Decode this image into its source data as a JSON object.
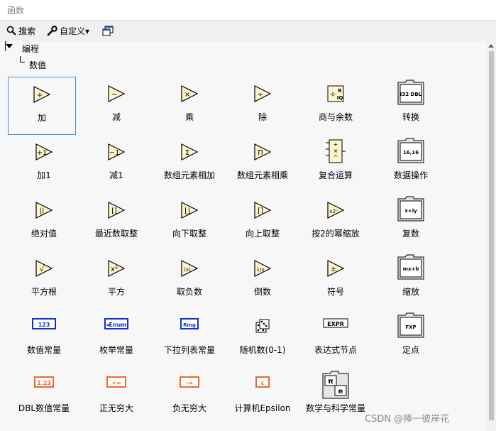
{
  "window": {
    "title": "函数"
  },
  "toolbar": {
    "search_label": "搜索",
    "customize_label": "自定义▾"
  },
  "tree": {
    "root_label": "编程",
    "child_label": "数值"
  },
  "palette": [
    {
      "label": "加",
      "icon": "add-icon",
      "glyph": "+",
      "kind": "tri"
    },
    {
      "label": "减",
      "icon": "subtract-icon",
      "glyph": "−",
      "kind": "tri"
    },
    {
      "label": "乘",
      "icon": "multiply-icon",
      "glyph": "×",
      "kind": "tri"
    },
    {
      "label": "除",
      "icon": "divide-icon",
      "glyph": "÷",
      "kind": "tri"
    },
    {
      "label": "商与余数",
      "icon": "quotient-remainder-icon",
      "glyph": "÷R",
      "kind": "box"
    },
    {
      "label": "转换",
      "icon": "conversion-folder-icon",
      "glyph": "I32 DBL",
      "kind": "folder"
    },
    {
      "label": "加1",
      "icon": "increment-icon",
      "glyph": "+1",
      "kind": "tri"
    },
    {
      "label": "减1",
      "icon": "decrement-icon",
      "glyph": "−1",
      "kind": "tri"
    },
    {
      "label": "数组元素相加",
      "icon": "add-array-elements-icon",
      "glyph": "Σ",
      "kind": "tri"
    },
    {
      "label": "数组元素相乘",
      "icon": "multiply-array-elements-icon",
      "glyph": "Π",
      "kind": "tri"
    },
    {
      "label": "复合运算",
      "icon": "compound-arithmetic-icon",
      "glyph": "+×",
      "kind": "compound"
    },
    {
      "label": "数据操作",
      "icon": "data-manipulation-folder-icon",
      "glyph": "16,16",
      "kind": "folder"
    },
    {
      "label": "绝对值",
      "icon": "absolute-value-icon",
      "glyph": "||",
      "kind": "tri"
    },
    {
      "label": "最近数取整",
      "icon": "round-nearest-icon",
      "glyph": "[]",
      "kind": "tri"
    },
    {
      "label": "向下取整",
      "icon": "round-down-icon",
      "glyph": "⌊⌋",
      "kind": "tri"
    },
    {
      "label": "向上取整",
      "icon": "round-up-icon",
      "glyph": "⌈⌉",
      "kind": "tri"
    },
    {
      "label": "按2的幂缩放",
      "icon": "scale-power-of-2-icon",
      "glyph": "x2ⁿ",
      "kind": "tri"
    },
    {
      "label": "复数",
      "icon": "complex-folder-icon",
      "glyph": "x+iy",
      "kind": "folder"
    },
    {
      "label": "平方根",
      "icon": "square-root-icon",
      "glyph": "√",
      "kind": "tri"
    },
    {
      "label": "平方",
      "icon": "square-icon",
      "glyph": "x²",
      "kind": "tri"
    },
    {
      "label": "取负数",
      "icon": "negate-icon",
      "glyph": "(x)",
      "kind": "tri"
    },
    {
      "label": "倒数",
      "icon": "reciprocal-icon",
      "glyph": "1/x",
      "kind": "tri"
    },
    {
      "label": "符号",
      "icon": "sign-icon",
      "glyph": "±",
      "kind": "tri"
    },
    {
      "label": "缩放",
      "icon": "scaling-folder-icon",
      "glyph": "mx+b",
      "kind": "folder"
    },
    {
      "label": "数值常量",
      "icon": "numeric-constant-icon",
      "glyph": "123",
      "kind": "const-blue"
    },
    {
      "label": "枚举常量",
      "icon": "enum-constant-icon",
      "glyph": "◂Enum",
      "kind": "const-blue"
    },
    {
      "label": "下拉列表常量",
      "icon": "ring-constant-icon",
      "glyph": "Ring",
      "kind": "const-blue-small"
    },
    {
      "label": "随机数(0-1)",
      "icon": "random-number-icon",
      "glyph": "⚄",
      "kind": "dice"
    },
    {
      "label": "表达式节点",
      "icon": "expression-node-icon",
      "glyph": "EXPR",
      "kind": "expr"
    },
    {
      "label": "定点",
      "icon": "fixed-point-folder-icon",
      "glyph": "FXP",
      "kind": "folder"
    },
    {
      "label": "DBL数值常量",
      "icon": "dbl-constant-icon",
      "glyph": "1.23",
      "kind": "const-orange"
    },
    {
      "label": "正无穷大",
      "icon": "positive-infinity-icon",
      "glyph": "+∞",
      "kind": "const-orange"
    },
    {
      "label": "负无穷大",
      "icon": "negative-infinity-icon",
      "glyph": "-∞",
      "kind": "const-orange"
    },
    {
      "label": "计算机Epsilon",
      "icon": "machine-epsilon-icon",
      "glyph": "ε",
      "kind": "const-orange-small"
    },
    {
      "label": "数学与科学常量",
      "icon": "math-constants-folder-icon",
      "glyph": "π e",
      "kind": "folder-big"
    }
  ],
  "watermark": "CSDN @捧一彼岸花"
}
